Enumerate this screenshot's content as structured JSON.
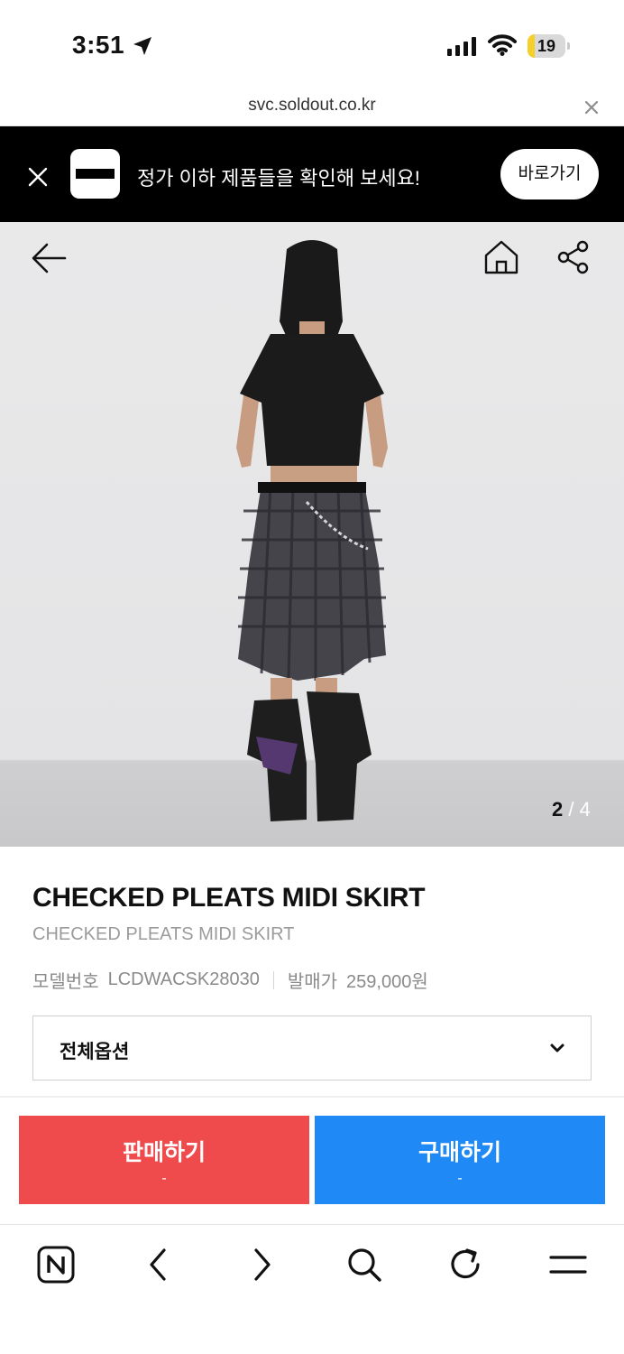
{
  "status_bar": {
    "time": "3:51",
    "battery_level": "19",
    "battery_fraction": 0.19,
    "battery_color": "#f7cf2a"
  },
  "url_bar": {
    "url": "svc.soldout.co.kr",
    "close_icon": "close-icon"
  },
  "banner": {
    "message": "정가 이하 제품들을 확인해 보세요!",
    "button_label": "바로가기",
    "close_icon": "close-icon"
  },
  "product_image": {
    "current_page": "2",
    "separator": "/",
    "total_pages": "4",
    "icons": [
      "back-arrow-icon",
      "home-icon",
      "share-icon"
    ]
  },
  "product": {
    "title": "CHECKED PLEATS MIDI SKIRT",
    "subtitle": "CHECKED PLEATS MIDI SKIRT",
    "model_label": "모델번호",
    "model_number": "LCDWACSK28030",
    "price_label": "발매가",
    "price": "259,000원"
  },
  "option_select": {
    "label": "전체옵션",
    "icon": "chevron-down-icon"
  },
  "actions": {
    "sell": {
      "label": "판매하기",
      "sub": "-",
      "color": "#ef4b4c"
    },
    "buy": {
      "label": "구매하기",
      "sub": "-",
      "color": "#1f8af6"
    }
  },
  "toolbar": {
    "icons": [
      "naver-home-icon",
      "back-icon",
      "forward-icon",
      "search-icon",
      "refresh-icon",
      "menu-icon"
    ]
  }
}
